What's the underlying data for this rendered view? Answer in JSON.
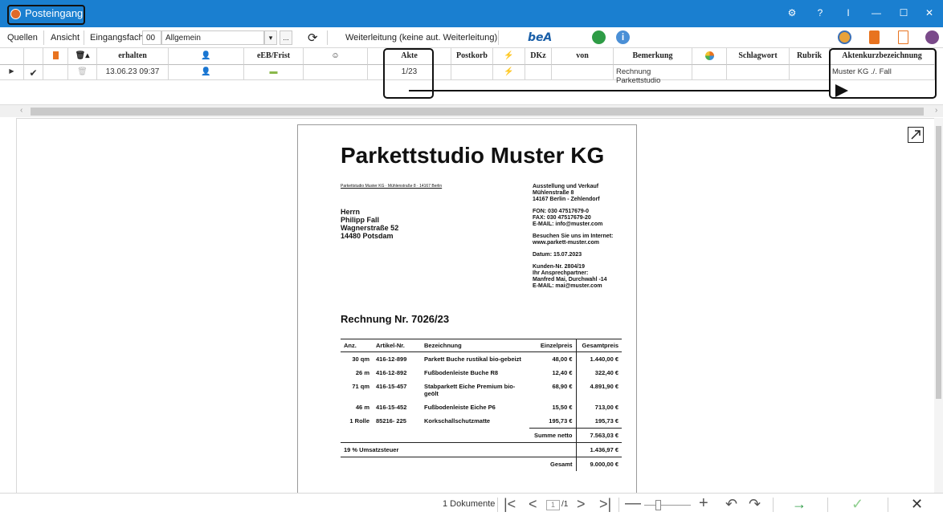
{
  "window": {
    "title": "Posteingang",
    "controls": [
      "⚙",
      "?",
      "I",
      "—",
      "☐",
      "✕"
    ]
  },
  "toolbar": {
    "menu_quellen": "Quellen",
    "menu_ansicht": "Ansicht",
    "eingangsfach_label": "Eingangsfach:",
    "eingangsfach_code": "00",
    "eingangsfach_name": "Allgemein",
    "dropdown_arrow": "▾",
    "more_button": "...",
    "refresh_icon": "⟳",
    "forwarding_text": "Weiterleitung  (keine aut. Weiterleitung)",
    "bea_label": "beA"
  },
  "grid": {
    "headers": {
      "erhalten": "erhalten",
      "eeb": "eEB/Frist",
      "akte": "Akte",
      "postkorb": "Postkorb",
      "dkz": "DKz",
      "von": "von",
      "bemerkung": "Bemerkung",
      "schlagwort": "Schlagwort",
      "rubrik": "Rubrik",
      "aktenkurz": "Aktenkurzbezeichnung"
    },
    "row": {
      "erhalten": "13.06.23 09:37",
      "akte": "1/23",
      "bemerkung": "Rechnung Parkettstudio",
      "aktenkurz": "Muster KG ./. Fall"
    }
  },
  "document": {
    "title": "Parkettstudio Muster KG",
    "sender_line": "Parkettstudio Muster KG · Mühlenstraße 8 · 14167 Berlin",
    "company_block": [
      "Ausstellung und Verkauf",
      "Mühlenstraße 8",
      "14167 Berlin - Zehlendorf"
    ],
    "contact_block": [
      "FON: 030 47517679-0",
      "FAX:  030 47517679-20",
      "E-MAIL: info@muster.com"
    ],
    "web_block": [
      "Besuchen Sie uns im Internet:",
      "www.parkett-muster.com"
    ],
    "date_line": "Datum: 15.07.2023",
    "customer_block": [
      "Kunden-Nr. 2804/19",
      "Ihr Ansprechpartner:",
      "Manfred Mai, Durchwahl -14",
      "E-MAIL: mai@muster.com"
    ],
    "recipient": [
      "Herrn",
      "Philipp Fall",
      "Wagnerstraße 52",
      "14480 Potsdam"
    ],
    "invoice_title": "Rechnung Nr. 7026/23",
    "table_headers": {
      "anz": "Anz.",
      "artikel": "Artikel-Nr.",
      "bez": "Bezeichnung",
      "einzel": "Einzelpreis",
      "gesamt": "Gesamtpreis"
    },
    "items": [
      {
        "anz": "30 qm",
        "art": "416-12-899",
        "bez": "Parkett Buche rustikal bio-gebeizt",
        "einzel": "48,00 €",
        "gesamt": "1.440,00 €"
      },
      {
        "anz": "26 m",
        "art": "416-12-892",
        "bez": "Fußbodenleiste Buche R8",
        "einzel": "12,40 €",
        "gesamt": "322,40 €"
      },
      {
        "anz": "71 qm",
        "art": "416-15-457",
        "bez": "Stabparkett Eiche Premium bio-geölt",
        "einzel": "68,90 €",
        "gesamt": "4.891,90 €"
      },
      {
        "anz": "46 m",
        "art": "416-15-452",
        "bez": "Fußbodenleiste Eiche P6",
        "einzel": "15,50 €",
        "gesamt": "713,00 €"
      },
      {
        "anz": "1 Rolle",
        "art": "85216- 225",
        "bez": "Korkschallschutzmatte",
        "einzel": "195,73 €",
        "gesamt": "195,73 €"
      }
    ],
    "summe_netto_label": "Summe netto",
    "summe_netto": "7.563,03 €",
    "ust_label": "19 % Umsatzsteuer",
    "ust": "1.436,97 €",
    "gesamt_label": "Gesamt",
    "gesamt": "9.000,00 €"
  },
  "statusbar": {
    "doc_count": "1 Dokumente",
    "page_current": "1",
    "page_total": "/1"
  },
  "colors": {
    "titlebar": "#1a7fd0",
    "accent_orange": "#e8731f",
    "bea_blue": "#1a5fa8",
    "confirm_green": "#2e9c46"
  }
}
